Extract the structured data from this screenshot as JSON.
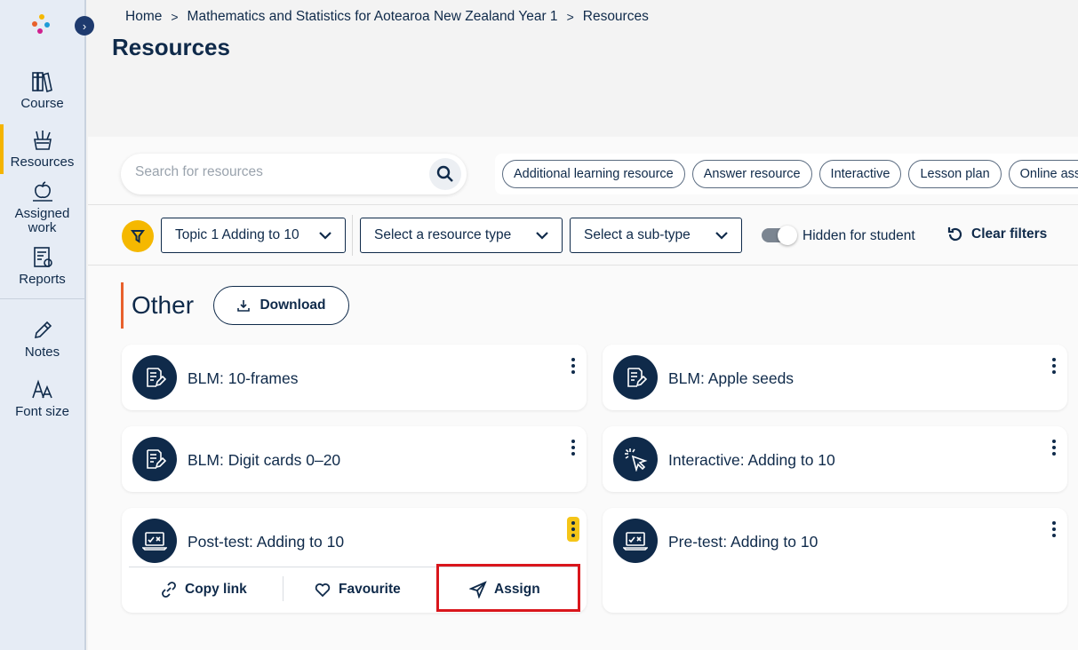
{
  "sidebar": {
    "items": [
      {
        "label": "Course",
        "icon": "books-icon"
      },
      {
        "label": "Resources",
        "icon": "resources-icon"
      },
      {
        "label": "Assigned work",
        "icon": "assigned-work-icon"
      },
      {
        "label": "Reports",
        "icon": "reports-icon"
      },
      {
        "label": "Notes",
        "icon": "pencil-icon"
      },
      {
        "label": "Font size",
        "icon": "font-size-icon"
      }
    ],
    "active": "Resources"
  },
  "breadcrumb": [
    "Home",
    "Mathematics and Statistics for Aotearoa New Zealand Year 1",
    "Resources"
  ],
  "page": {
    "title": "Resources"
  },
  "search": {
    "placeholder": "Search for resources"
  },
  "chips": [
    "Additional learning resource",
    "Answer resource",
    "Interactive",
    "Lesson plan",
    "Online asse"
  ],
  "filters": {
    "topic": "Topic 1 Adding to 10",
    "resource_type": "Select a resource type",
    "sub_type": "Select a sub-type",
    "toggle_label": "Hidden for student",
    "clear_label": "Clear filters"
  },
  "section": {
    "title": "Other",
    "download_label": "Download"
  },
  "cards": [
    {
      "title": "BLM: 10-frames",
      "icon": "worksheet-icon"
    },
    {
      "title": "BLM: Apple seeds",
      "icon": "worksheet-icon"
    },
    {
      "title": "BLM: Digit cards 0–20",
      "icon": "worksheet-icon"
    },
    {
      "title": "Interactive: Adding to 10",
      "icon": "cursor-click-icon"
    },
    {
      "title": "Post-test: Adding to 10",
      "icon": "laptop-test-icon"
    },
    {
      "title": "Pre-test: Adding to 10",
      "icon": "laptop-test-icon"
    }
  ],
  "card_actions": {
    "copy_link": "Copy link",
    "favourite": "Favourite",
    "assign": "Assign"
  },
  "colors": {
    "accent": "#f5b800",
    "navy": "#0f2a4a",
    "section_bar": "#e8602c",
    "highlight": "#d9161c"
  }
}
